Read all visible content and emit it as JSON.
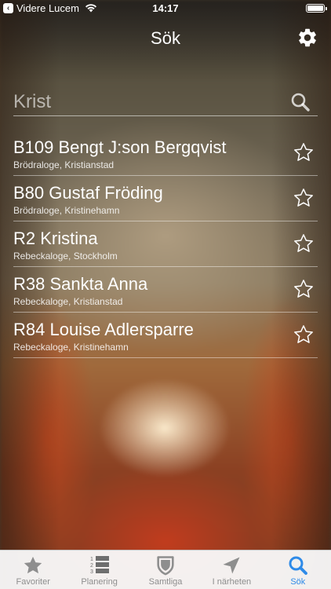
{
  "status_bar": {
    "back_label": "Videre Lucem",
    "time": "14:17"
  },
  "nav": {
    "title": "Sök"
  },
  "search": {
    "value": "Krist"
  },
  "results": [
    {
      "title": "B109 Bengt J:son Bergqvist",
      "subtitle": "Brödraloge, Kristianstad"
    },
    {
      "title": "B80 Gustaf Fröding",
      "subtitle": "Brödraloge, Kristinehamn"
    },
    {
      "title": "R2 Kristina",
      "subtitle": "Rebeckaloge, Stockholm"
    },
    {
      "title": "R38 Sankta Anna",
      "subtitle": "Rebeckaloge, Kristianstad"
    },
    {
      "title": "R84 Louise Adlersparre",
      "subtitle": "Rebeckaloge, Kristinehamn"
    }
  ],
  "tab_bar": {
    "tabs": [
      {
        "label": "Favoriter",
        "icon": "star-icon"
      },
      {
        "label": "Planering",
        "icon": "numbered-list-icon"
      },
      {
        "label": "Samtliga",
        "icon": "shield-icon"
      },
      {
        "label": "I närheten",
        "icon": "location-arrow-icon"
      },
      {
        "label": "Sök",
        "icon": "search-icon"
      }
    ],
    "active_index": 4
  },
  "colors": {
    "accent": "#2f8be8",
    "tab_inactive": "#8e8e8e"
  }
}
